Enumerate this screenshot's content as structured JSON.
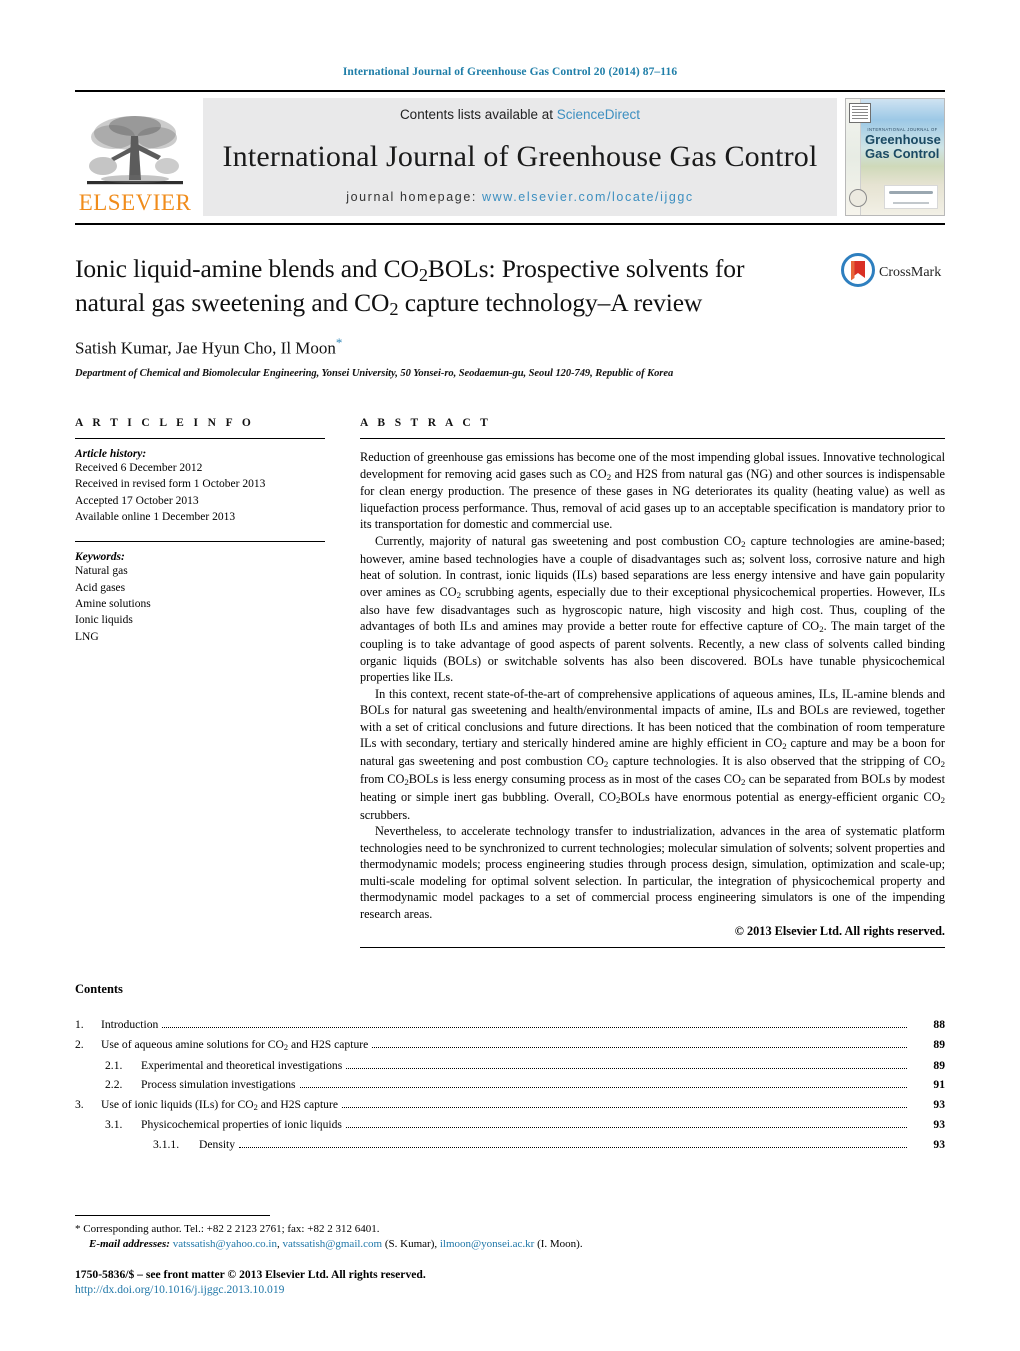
{
  "running_head": "International Journal of Greenhouse Gas Control 20 (2014) 87–116",
  "masthead": {
    "publisher": "ELSEVIER",
    "contents_prefix": "Contents lists available at ",
    "sciencedirect": "ScienceDirect",
    "journal_title": "International Journal of Greenhouse Gas Control",
    "homepage_prefix": "journal homepage: ",
    "homepage_url": "www.elsevier.com/locate/ijggc",
    "cover": {
      "kicker": "INTERNATIONAL JOURNAL OF",
      "line1": "Greenhouse",
      "line2": "Gas Control"
    },
    "colors": {
      "link_blue": "#3d8fc0",
      "elsevier_orange": "#f08c1b",
      "panel_gray": "#e9e9ea"
    }
  },
  "title_block": {
    "title_line1": "Ionic liquid-amine blends and CO",
    "title_line1_sub": "2",
    "title_line1_rest": "BOLs: Prospective solvents for",
    "title_line2_a": "natural gas sweetening and CO",
    "title_line2_sub": "2",
    "title_line2_rest": " capture technology–A review",
    "authors": "Satish Kumar, Jae Hyun Cho, Il Moon",
    "corresponding_marker": "*",
    "affiliation": "Department of Chemical and Biomolecular Engineering, Yonsei University, 50 Yonsei-ro, Seodaemun-gu, Seoul 120-749, Republic of Korea",
    "crossmark_label": "CrossMark"
  },
  "article_info": {
    "heading": "A R T I C L E   I N F O",
    "history_title": "Article history:",
    "history": [
      "Received 6 December 2012",
      "Received in revised form 1 October 2013",
      "Accepted 17 October 2013",
      "Available online 1 December 2013"
    ],
    "keywords_title": "Keywords:",
    "keywords": [
      "Natural gas",
      "Acid gases",
      "Amine solutions",
      "Ionic liquids",
      "LNG"
    ]
  },
  "abstract": {
    "heading": "A B S T R A C T",
    "paragraphs": [
      "Reduction of greenhouse gas emissions has become one of the most impending global issues. Innovative technological development for removing acid gases such as CO2 and H2S from natural gas (NG) and other sources is indispensable for clean energy production. The presence of these gases in NG deteriorates its quality (heating value) as well as liquefaction process performance. Thus, removal of acid gases up to an acceptable specification is mandatory prior to its transportation for domestic and commercial use.",
      "Currently, majority of natural gas sweetening and post combustion CO2 capture technologies are amine-based; however, amine based technologies have a couple of disadvantages such as; solvent loss, corrosive nature and high heat of solution. In contrast, ionic liquids (ILs) based separations are less energy intensive and have gain popularity over amines as CO2 scrubbing agents, especially due to their exceptional physicochemical properties. However, ILs also have few disadvantages such as hygroscopic nature, high viscosity and high cost. Thus, coupling of the advantages of both ILs and amines may provide a better route for effective capture of CO2. The main target of the coupling is to take advantage of good aspects of parent solvents. Recently, a new class of solvents called binding organic liquids (BOLs) or switchable solvents has also been discovered. BOLs have tunable physicochemical properties like ILs.",
      "In this context, recent state-of-the-art of comprehensive applications of aqueous amines, ILs, IL-amine blends and BOLs for natural gas sweetening and health/environmental impacts of amine, ILs and BOLs are reviewed, together with a set of critical conclusions and future directions. It has been noticed that the combination of room temperature ILs with secondary, tertiary and sterically hindered amine are highly efficient in CO2 capture and may be a boon for natural gas sweetening and post combustion CO2 capture technologies. It is also observed that the stripping of CO2 from CO2BOLs is less energy consuming process as in most of the cases CO2 can be separated from BOLs by modest heating or simple inert gas bubbling. Overall, CO2BOLs have enormous potential as energy-efficient organic CO2 scrubbers.",
      "Nevertheless, to accelerate technology transfer to industrialization, advances in the area of systematic platform technologies need to be synchronized to current technologies; molecular simulation of solvents; solvent properties and thermodynamic models; process engineering studies through process design, simulation, optimization and scale-up; multi-scale modeling for optimal solvent selection. In particular, the integration of physicochemical property and thermodynamic model packages to a set of commercial process engineering simulators is one of the impending research areas."
    ],
    "copyright": "© 2013 Elsevier Ltd. All rights reserved."
  },
  "contents": {
    "heading": "Contents",
    "rows": [
      {
        "level": 1,
        "number": "1.",
        "label": "Introduction",
        "page": "88"
      },
      {
        "level": 1,
        "number": "2.",
        "label": "Use of aqueous amine solutions for CO2 and H2S capture",
        "page": "89"
      },
      {
        "level": 2,
        "number": "2.1.",
        "label": "Experimental and theoretical investigations",
        "page": "89"
      },
      {
        "level": 2,
        "number": "2.2.",
        "label": "Process simulation investigations",
        "page": "91"
      },
      {
        "level": 1,
        "number": "3.",
        "label": "Use of ionic liquids (ILs) for CO2 and H2S capture",
        "page": "93"
      },
      {
        "level": 2,
        "number": "3.1.",
        "label": "Physicochemical properties of ionic liquids",
        "page": "93"
      },
      {
        "level": 3,
        "number": "3.1.1.",
        "label": "Density",
        "page": "93"
      }
    ]
  },
  "footnote": {
    "corresponding": "* Corresponding author. Tel.: +82 2 2123 2761; fax: +82 2 312 6401.",
    "email_label": "E-mail addresses:",
    "emails": [
      {
        "address": "vatssatish@yahoo.co.in",
        "sep": ", "
      },
      {
        "address": "vatssatish@gmail.com",
        "sep": " (S. Kumar), "
      },
      {
        "address": "ilmoon@yonsei.ac.kr",
        "sep": " (I. Moon)."
      }
    ],
    "issn_line": "1750-5836/$ – see front matter © 2013 Elsevier Ltd. All rights reserved.",
    "doi": "http://dx.doi.org/10.1016/j.ijggc.2013.10.019"
  }
}
